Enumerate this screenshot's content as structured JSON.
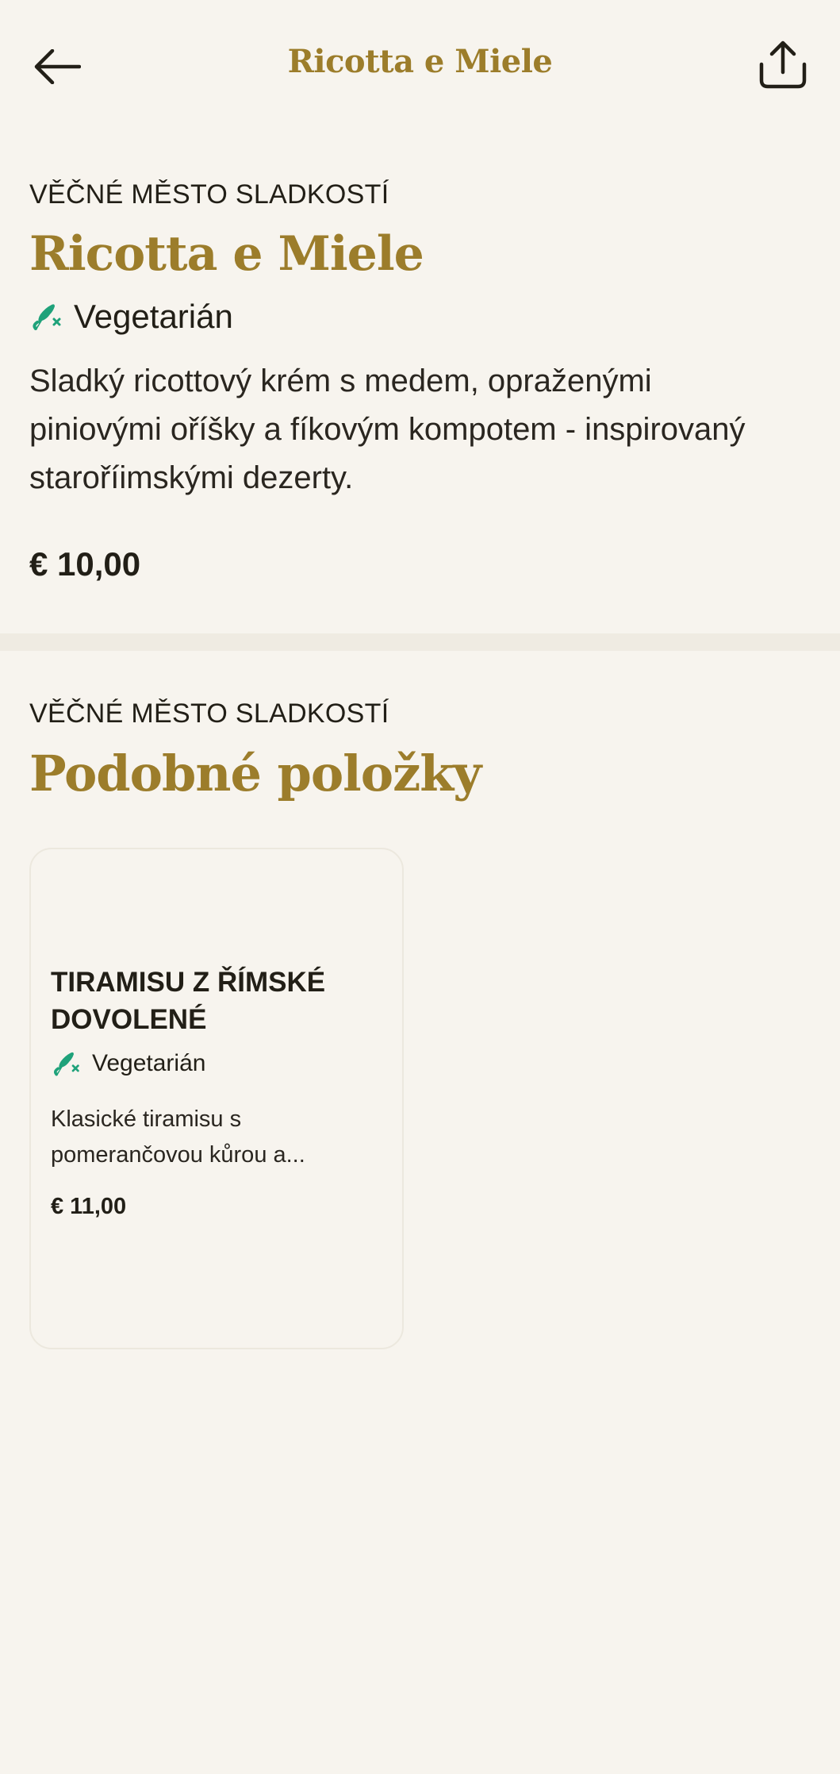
{
  "header": {
    "title": "Ricotta e Miele",
    "back_icon": "arrow-left-icon",
    "share_icon": "share-icon"
  },
  "item": {
    "category": "VĚČNÉ MĚSTO SLADKOSTÍ",
    "name": "Ricotta e Miele",
    "diet": "Vegetarián",
    "description": "Sladký ricottový krém s medem, opraženými piniovými oříšky a fíkovým kompotem - inspirovaný staroříimskými dezerty.",
    "price": "€ 10,00"
  },
  "similar": {
    "category": "VĚČNÉ MĚSTO SLADKOSTÍ",
    "title": "Podobné položky",
    "items": [
      {
        "name": "TIRAMISU Z ŘÍMSKÉ DOVOLENÉ",
        "diet": "Vegetarián",
        "description": "Klasické tiramisu s pomerančovou kůrou a...",
        "price": "€ 11,00"
      }
    ]
  },
  "colors": {
    "accent": "#9c7d2b",
    "background": "#f7f4ee",
    "veg_icon": "#1fa27a",
    "text": "#221f17"
  }
}
